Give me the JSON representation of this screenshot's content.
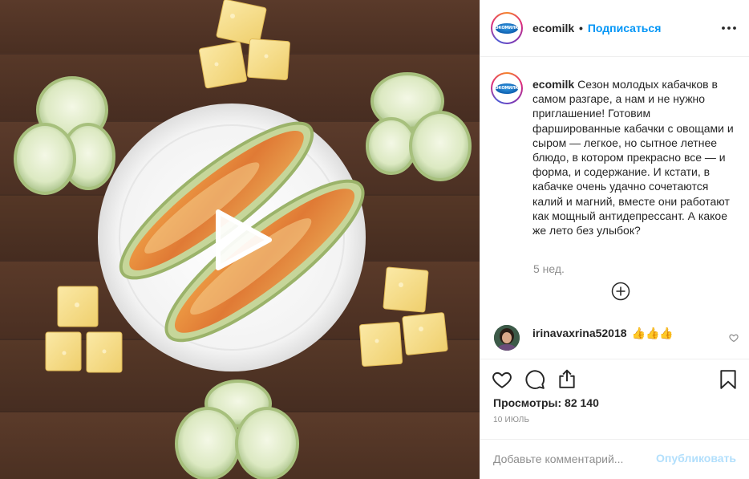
{
  "post": {
    "author": "ecomilk",
    "separator": "•",
    "follow_label": "Подписаться",
    "logo_text": "ЭКОМИЛК",
    "caption": "Сезон молодых кабачков в самом разгаре, а нам и не нужно приглашение! Готовим фаршированные кабачки с овощами и сыром — легкое, но сытное летнее блюдо, в котором прекрасно все — и форма, и содержание. И кстати, в кабачке очень удачно сочетаются калий и магний, вместе они работают как мощный антидепрессант. А какое же лето без улыбок?",
    "caption_time": "5 нед.",
    "views_label": "Просмотры: 82 140",
    "date": "10 июль"
  },
  "comment": {
    "author": "irinavaxrina52018",
    "text": "👍👍👍"
  },
  "add_comment": {
    "placeholder": "Добавьте комментарий...",
    "publish_label": "Опубликовать"
  },
  "icons": {
    "more": "more-horizontal-icon",
    "load_more": "plus-circle-icon",
    "like": "heart-icon",
    "comment": "comment-icon",
    "share": "share-icon",
    "save": "bookmark-icon",
    "play": "play-icon"
  },
  "colors": {
    "accent": "#0095f6",
    "publish_disabled": "#b2dffc",
    "muted": "#8e8e8e"
  }
}
